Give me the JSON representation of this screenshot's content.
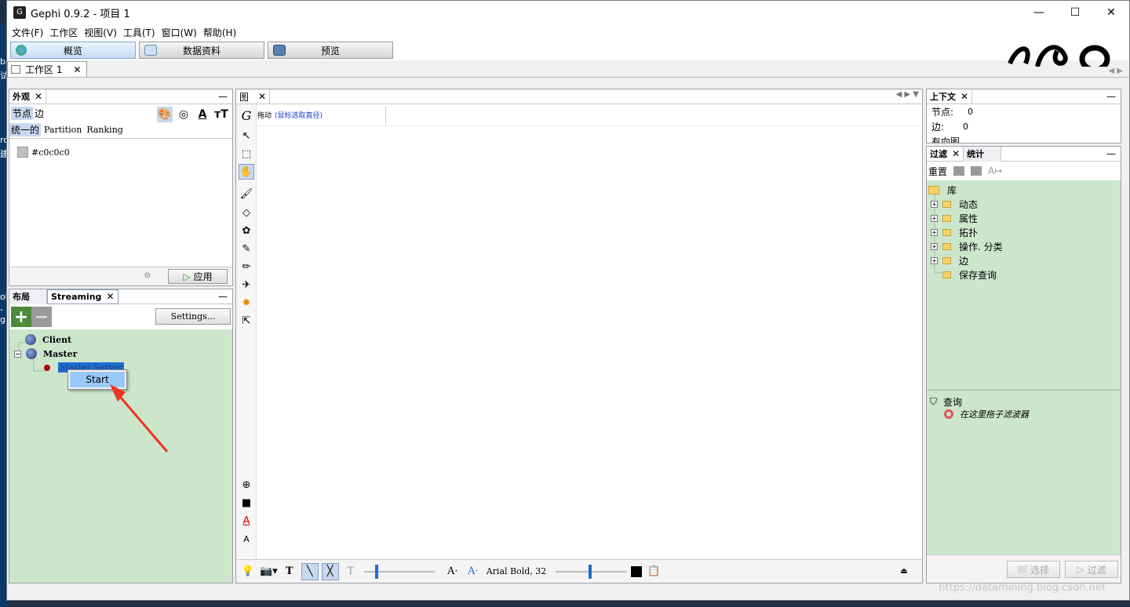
{
  "window": {
    "title": "Gephi 0.9.2 - 项目 1",
    "minimize": "—",
    "maximize": "☐",
    "close": "✕"
  },
  "desktop": {
    "edge_chars": [
      "ba",
      "试",
      "ro",
      "建",
      "oh",
      "-g"
    ]
  },
  "menu": [
    "文件(F)",
    "工作区",
    "视图(V)",
    "工具(T)",
    "窗口(W)",
    "帮助(H)"
  ],
  "modes": [
    {
      "label": "概览",
      "active": true
    },
    {
      "label": "数据资料",
      "active": false
    },
    {
      "label": "预览",
      "active": false
    }
  ],
  "workspace_tab": {
    "label": "工作区 1",
    "close": "✕"
  },
  "appearance": {
    "tab_appearance": "外观",
    "tab_node": "节点",
    "tab_edge": "边",
    "mode_unique": "统一的",
    "mode_partition": "Partition",
    "mode_ranking": "Ranking",
    "color_value": "#c0c0c0",
    "apply": "应用"
  },
  "layout_panel": {
    "tab_layout": "布局",
    "tab_streaming": "Streaming",
    "settings": "Settings..."
  },
  "streaming_tree": {
    "client": "Client",
    "master": "Master",
    "master_server": "Master Server",
    "context_menu_item": "Start"
  },
  "graph": {
    "tab": "图",
    "tool_label": "拖动",
    "tool_hint": "(鼠标选取直径)",
    "font_label": "Arial Bold, 32"
  },
  "context": {
    "tab": "上下文",
    "nodes_label": "节点:",
    "nodes_value": "0",
    "edges_label": "边:",
    "edges_value": "0",
    "type_label": "有向图"
  },
  "filters": {
    "tab_filter": "过滤",
    "tab_stats": "统计",
    "reset": "重置",
    "library": "库",
    "items": [
      "动态",
      "属性",
      "拓扑",
      "操作. 分类",
      "边",
      "保存查询"
    ],
    "query": "查询",
    "drag_hint": "在这里拖子滤波器",
    "select_btn": "选择",
    "filter_btn": "过滤"
  },
  "watermark": "https://datamining.blog.csdn.net",
  "colors": {
    "accent": "#1e6fd0",
    "panel_green": "#cce6cc",
    "arrow": "#ee3322"
  }
}
